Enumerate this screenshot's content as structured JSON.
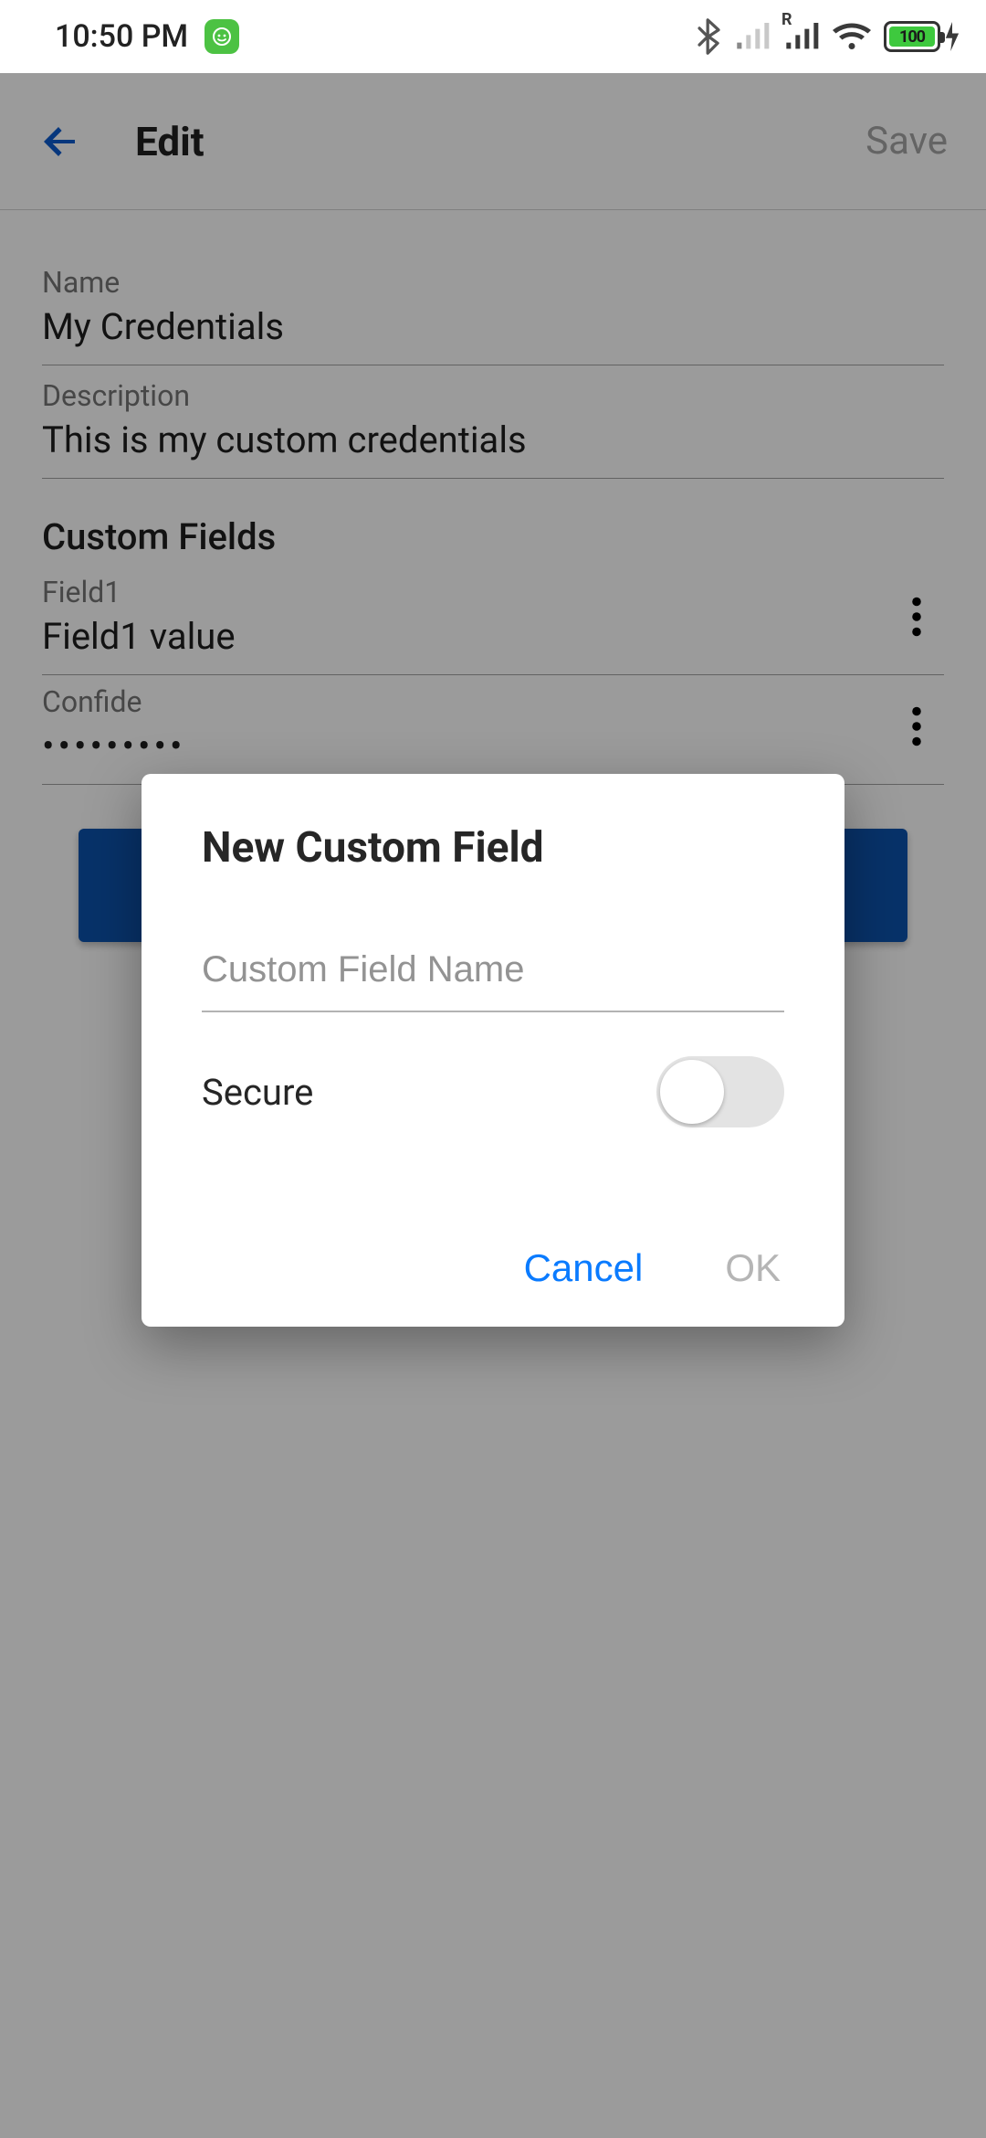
{
  "status": {
    "time": "10:50 PM",
    "battery_pct": "100",
    "signal_label": "R"
  },
  "appbar": {
    "title": "Edit",
    "save_label": "Save"
  },
  "fields": {
    "name_label": "Name",
    "name_value": "My Credentials",
    "desc_label": "Description",
    "desc_value": "This is my custom credentials"
  },
  "custom": {
    "section": "Custom Fields",
    "items": [
      {
        "label": "Field1",
        "value": "Field1 value",
        "masked": false
      },
      {
        "label": "Confide",
        "value": "•••••••••",
        "masked": true
      }
    ]
  },
  "dialog": {
    "title": "New Custom Field",
    "input_placeholder": "Custom Field Name",
    "input_value": "",
    "secure_label": "Secure",
    "secure_on": false,
    "cancel": "Cancel",
    "ok": "OK"
  }
}
